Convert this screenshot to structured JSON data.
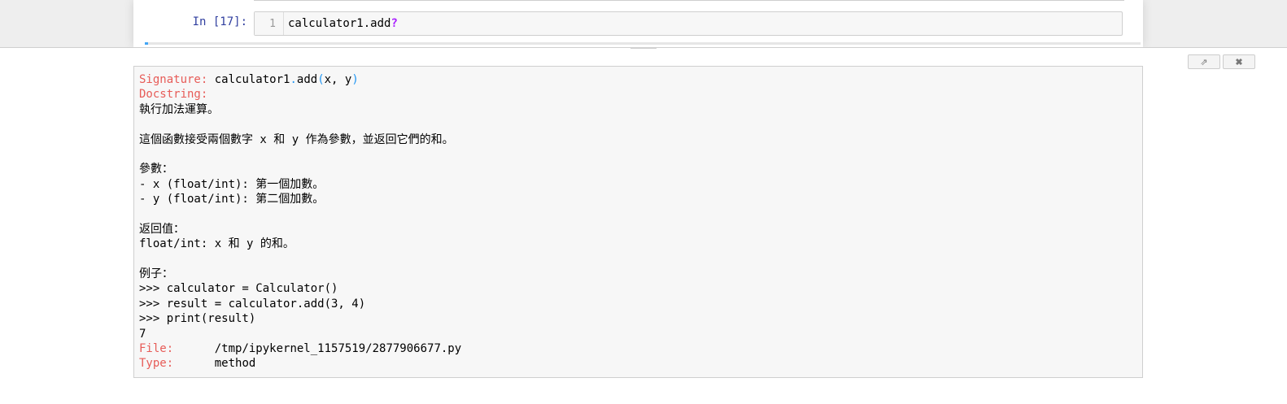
{
  "cell": {
    "prompt": "In [17]:",
    "line_number": "1",
    "code": "calculator1.add",
    "code_suffix": "?"
  },
  "pager": {
    "expand_icon": "external-link-icon",
    "close_icon": "close-icon",
    "expand_glyph": "⇗",
    "close_glyph": "✖",
    "signature_label": "Signature:",
    "signature_obj": "calculator1",
    "signature_dot": ".",
    "signature_func": "add",
    "signature_open": "(",
    "signature_args": "x, y",
    "signature_close": ")",
    "docstring_label": "Docstring:",
    "docstring_lines": [
      "執行加法運算。",
      "",
      "這個函數接受兩個數字 x 和 y 作為參數，並返回它們的和。",
      "",
      "參數：",
      "- x (float/int): 第一個加數。",
      "- y (float/int): 第二個加數。",
      "",
      "返回值：",
      "float/int: x 和 y 的和。",
      "",
      "例子：",
      ">>> calculator = Calculator()",
      ">>> result = calculator.add(3, 4)",
      ">>> print(result)",
      "7"
    ],
    "file_label": "File:",
    "file_value": "/tmp/ipykernel_1157519/2877906677.py",
    "type_label": "Type:",
    "type_value": "method"
  }
}
